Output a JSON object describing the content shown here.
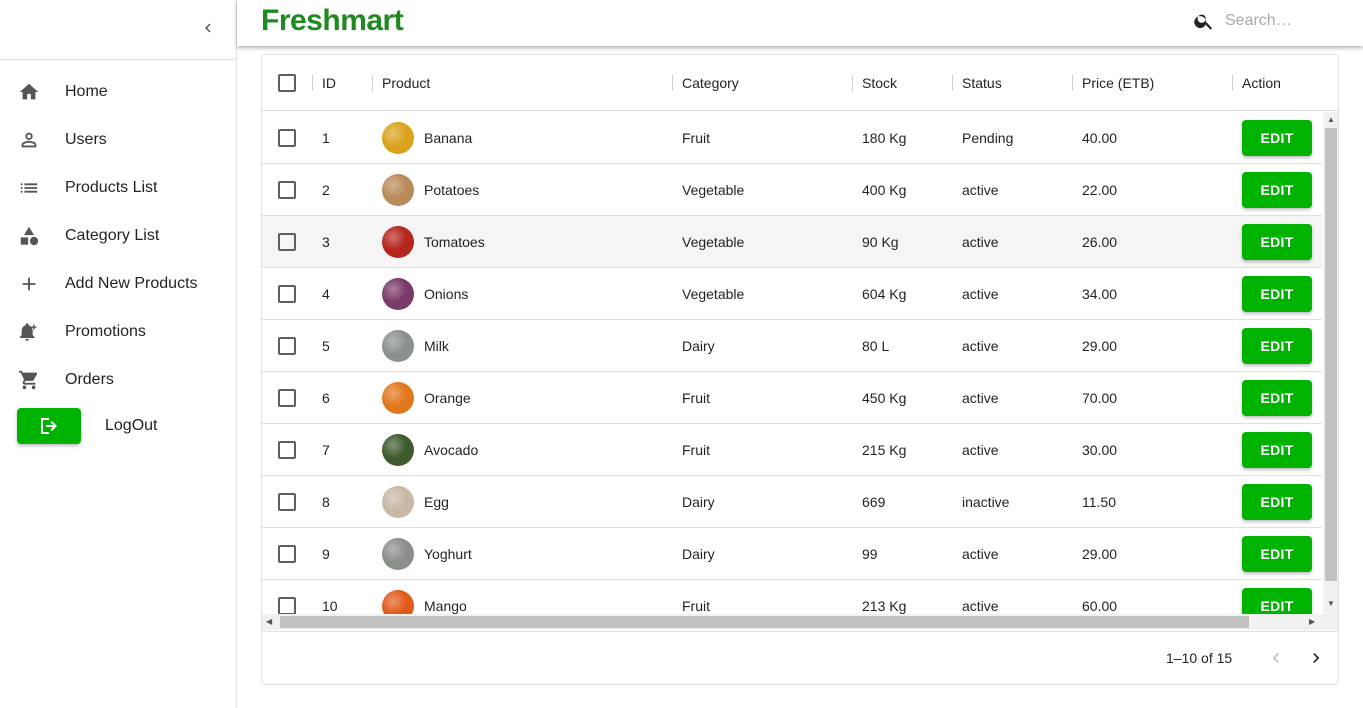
{
  "app": {
    "brand": "Freshmart"
  },
  "search": {
    "placeholder": "Search…"
  },
  "sidebar": {
    "items": [
      {
        "label": "Home",
        "icon": "home-icon"
      },
      {
        "label": "Users",
        "icon": "person-icon"
      },
      {
        "label": "Products List",
        "icon": "list-icon"
      },
      {
        "label": "Category List",
        "icon": "category-icon"
      },
      {
        "label": "Add New Products",
        "icon": "plus-icon"
      },
      {
        "label": "Promotions",
        "icon": "bell-plus-icon"
      },
      {
        "label": "Orders",
        "icon": "cart-icon"
      }
    ],
    "logout_label": "LogOut"
  },
  "table": {
    "headers": {
      "id": "ID",
      "product": "Product",
      "category": "Category",
      "stock": "Stock",
      "status": "Status",
      "price": "Price (ETB)",
      "action": "Action"
    },
    "edit_label": "EDIT",
    "rows": [
      {
        "id": "1",
        "product": "Banana",
        "category": "Fruit",
        "stock": "180 Kg",
        "status": "Pending",
        "price": "40.00",
        "thumb_color": "#d9a21b"
      },
      {
        "id": "2",
        "product": "Potatoes",
        "category": "Vegetable",
        "stock": "400 Kg",
        "status": "active",
        "price": "22.00",
        "thumb_color": "#b98a5a"
      },
      {
        "id": "3",
        "product": "Tomatoes",
        "category": "Vegetable",
        "stock": "90 Kg",
        "status": "active",
        "price": "26.00",
        "thumb_color": "#b5261d"
      },
      {
        "id": "4",
        "product": "Onions",
        "category": "Vegetable",
        "stock": "604 Kg",
        "status": "active",
        "price": "34.00",
        "thumb_color": "#7a3a6a"
      },
      {
        "id": "5",
        "product": "Milk",
        "category": "Dairy",
        "stock": "80 L",
        "status": "active",
        "price": "29.00",
        "thumb_color": "#8a9090"
      },
      {
        "id": "6",
        "product": "Orange",
        "category": "Fruit",
        "stock": "450 Kg",
        "status": "active",
        "price": "70.00",
        "thumb_color": "#e2761b"
      },
      {
        "id": "7",
        "product": "Avocado",
        "category": "Fruit",
        "stock": "215 Kg",
        "status": "active",
        "price": "30.00",
        "thumb_color": "#3e5a2e"
      },
      {
        "id": "8",
        "product": "Egg",
        "category": "Dairy",
        "stock": "669",
        "status": "inactive",
        "price": "11.50",
        "thumb_color": "#c8b8a6"
      },
      {
        "id": "9",
        "product": "Yoghurt",
        "category": "Dairy",
        "stock": "99",
        "status": "active",
        "price": "29.00",
        "thumb_color": "#8a8f8a"
      },
      {
        "id": "10",
        "product": "Mango",
        "category": "Fruit",
        "stock": "213 Kg",
        "status": "active",
        "price": "60.00",
        "thumb_color": "#e05a1a"
      }
    ],
    "highlighted_row": "3"
  },
  "pagination": {
    "text": "1–10 of 15"
  },
  "colors": {
    "brand": "#1f8a1f",
    "accent": "#00b300"
  }
}
